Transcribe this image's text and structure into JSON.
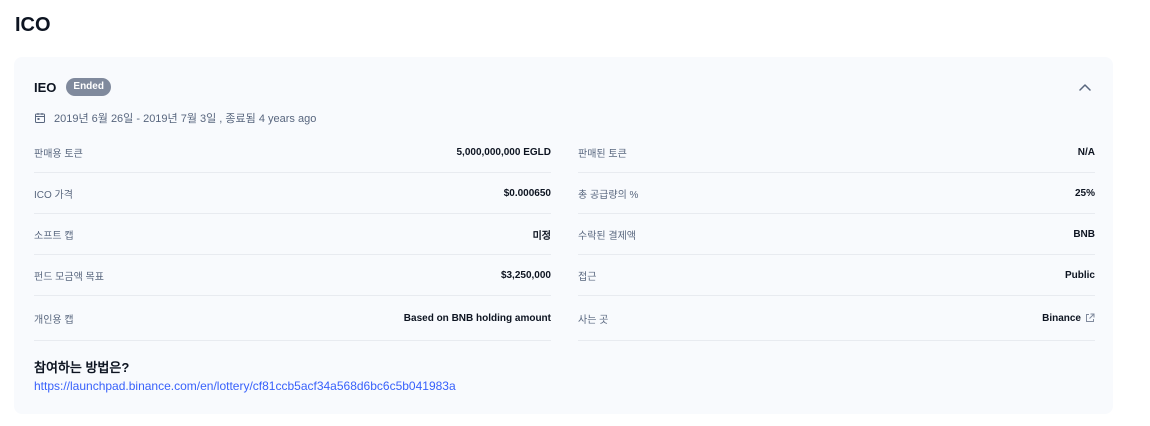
{
  "page": {
    "title": "ICO"
  },
  "card": {
    "title": "IEO",
    "status": "Ended",
    "date_range": "2019년 6월 26일 - 2019년 7월 3일 , 종료됨 4 years ago",
    "colors": {
      "badge": "#808a9d",
      "link": "#3861fb",
      "card_bg": "#f8fafd"
    }
  },
  "details": {
    "left": [
      {
        "label": "판매용 토큰",
        "value": "5,000,000,000 EGLD"
      },
      {
        "label": "ICO 가격",
        "value": "$0.000650"
      },
      {
        "label": "소프트 캡",
        "value": "미정"
      },
      {
        "label": "펀드 모금액 목표",
        "value": "$3,250,000"
      },
      {
        "label": "개인용 캡",
        "value": "Based on BNB holding amount"
      }
    ],
    "right": [
      {
        "label": "판매된 토큰",
        "value": "N/A"
      },
      {
        "label": "총 공급량의 %",
        "value": "25%"
      },
      {
        "label": "수락된 결제액",
        "value": "BNB"
      },
      {
        "label": "접근",
        "value": "Public"
      },
      {
        "label": "사는 곳",
        "value": "Binance",
        "icon": "external-link-icon"
      }
    ]
  },
  "how_to": {
    "title": "참여하는 방법은?",
    "link": "https://launchpad.binance.com/en/lottery/cf81ccb5acf34a568d6bc6c5b041983a"
  },
  "icons": {
    "collapse": "chevron-up-icon",
    "calendar": "calendar-icon"
  }
}
